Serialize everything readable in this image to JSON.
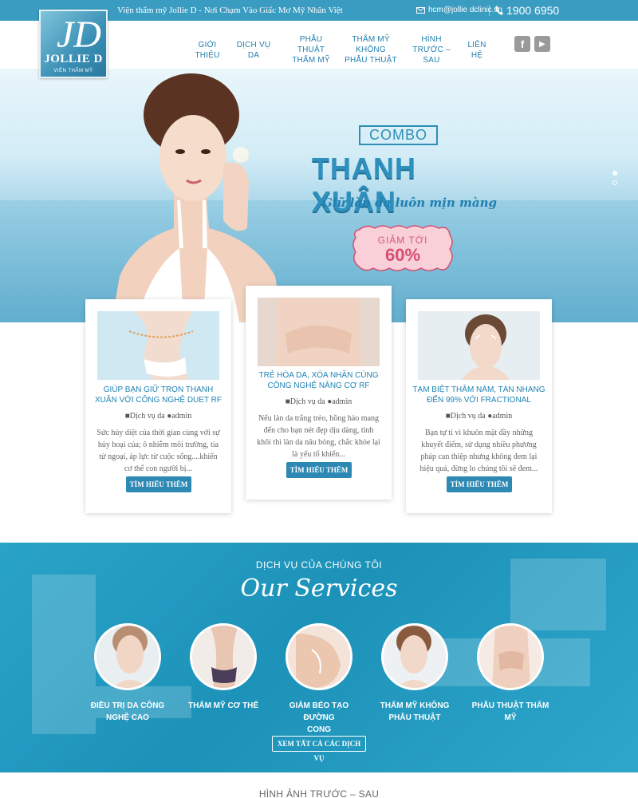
{
  "topbar": {
    "tagline": "Viện thẩm mỹ Jollie D - Nơi Chạm Vào Giấc Mơ Mỹ Nhân Việt",
    "email": "hcm@jollie dclinic.vn",
    "phone": "1900 6950"
  },
  "logo": {
    "monogram": "JD",
    "name": "JOLLIE D",
    "sub": "VIỆN THẨM MỸ"
  },
  "nav": {
    "items": [
      {
        "line1": "GIỚI THIỆU",
        "line2": ""
      },
      {
        "line1": "DỊCH VỤ DA",
        "line2": ""
      },
      {
        "line1": "PHẪU THUẬT",
        "line2": "THẨM MỸ"
      },
      {
        "line1": "THẨM MỸ KHÔNG",
        "line2": "PHẪU THUẬT"
      },
      {
        "line1": "HÌNH",
        "line2": "TRƯỚC – SAU"
      },
      {
        "line1": "LIÊN HỆ",
        "line2": ""
      }
    ],
    "social": [
      {
        "name": "facebook-icon",
        "glyph": "f"
      },
      {
        "name": "youtube-icon",
        "glyph": "▶"
      }
    ]
  },
  "hero": {
    "combo": "COMBO",
    "title": "THANH XUÂN",
    "subtitle": "Giữ làn da luôn mịn màng",
    "badge_line1": "GIẢM TỚI",
    "badge_line2": "60%",
    "slides": 2,
    "active_slide": 1
  },
  "cards": [
    {
      "title": "GIÚP BẠN GIỮ TRỌN THANH XUÂN VỚI CÔNG NGHỆ DUET RF",
      "category": "Dịch vụ da",
      "author": "admin",
      "excerpt": "Sức hủy diệt của thời gian cùng với sự hủy hoại của; ô nhiễm môi trường, tia tử ngoại, áp lực từ cuộc sống....khiến cơ thể con người bị...",
      "button": "TÌM HIỂU THÊM"
    },
    {
      "title": "TRẺ HÓA DA, XÓA NHĂN CÙNG CÔNG NGHỆ NÂNG CƠ RF",
      "category": "Dịch vụ da",
      "author": "admin",
      "excerpt": "Nếu làn da trắng trẻo, hồng hào mang đến cho bạn nét đẹp dịu dàng, tinh khôi thì làn da nâu bóng, chắc khỏe lại là yếu tố khiến...",
      "button": "TÌM HIỂU THÊM"
    },
    {
      "title": "TẠM BIỆT THÂM NÁM, TÀN NHANG ĐẾN 99% VỚI FRACTIONAL",
      "category": "Dịch vụ da",
      "author": "admin",
      "excerpt": "Bạn tự ti vì khuôn mặt đầy những khuyết điểm, sử dụng nhiều phương pháp can thiệp nhưng không đem lại hiệu quả, đừng lo chúng tôi sẽ đem...",
      "button": "TÌM HIỂU THÊM"
    }
  ],
  "services": {
    "heading": "DỊCH VỤ CỦA CHÚNG TÔI",
    "script": "Our Services",
    "items": [
      {
        "line1": "ĐIỀU TRỊ DA CÔNG",
        "line2": "NGHỆ CAO"
      },
      {
        "line1": "THẨM MỸ CƠ THỂ",
        "line2": ""
      },
      {
        "line1": "GIẢM BÉO TẠO ĐƯỜNG",
        "line2": "CONG"
      },
      {
        "line1": "THẨM MỸ KHÔNG",
        "line2": "PHẪU THUẬT"
      },
      {
        "line1": "PHẪU THUẬT THẨM",
        "line2": "MỸ"
      }
    ],
    "button": "XEM TẤT CẢ CÁC DỊCH VỤ"
  },
  "bottom": {
    "title": "HÌNH ẢNH TRƯỚC – SAU"
  },
  "colors": {
    "brand": "#3a9cc1",
    "link": "#1f7fae",
    "button": "#2d88b3",
    "badge": "#f7c9d3"
  }
}
